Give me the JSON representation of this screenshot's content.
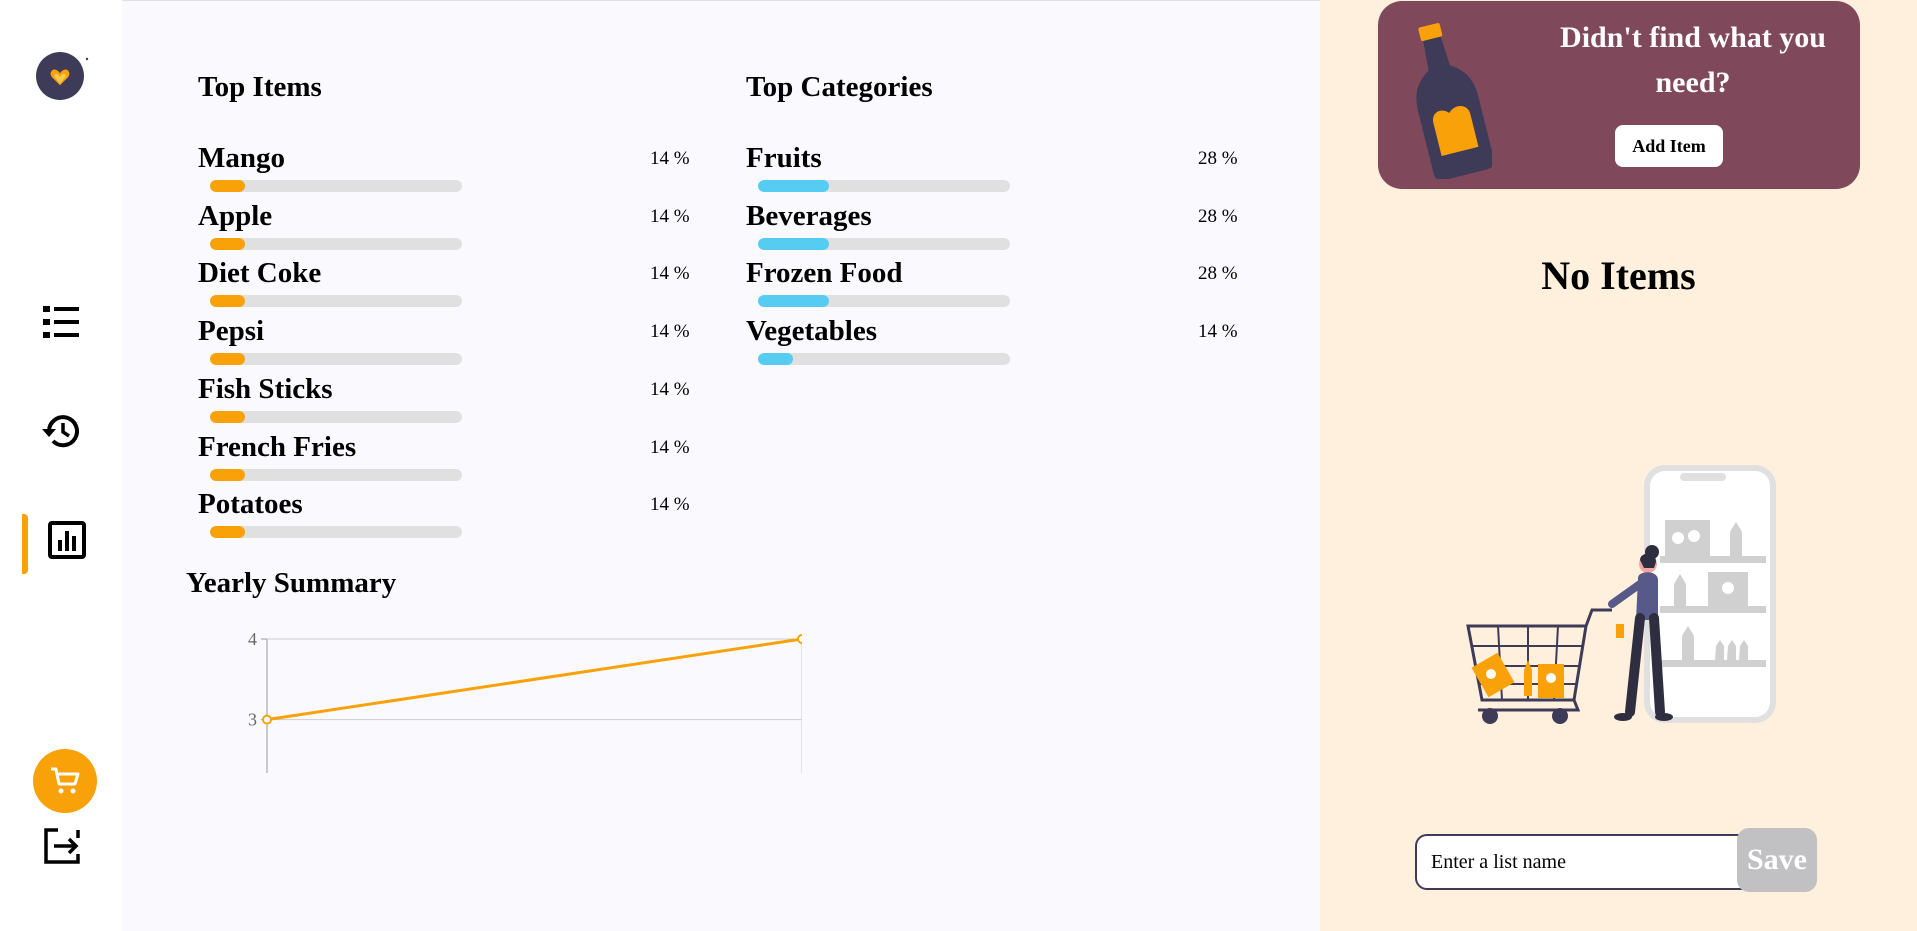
{
  "sidebar": {
    "logo_icon": "heart-logo-icon",
    "nav": [
      {
        "name": "items",
        "icon": "list-icon"
      },
      {
        "name": "history",
        "icon": "history-icon"
      },
      {
        "name": "statistics",
        "icon": "chart-icon",
        "active": true
      }
    ],
    "cart_icon": "cart-icon",
    "logout_icon": "logout-icon"
  },
  "main": {
    "top_items": {
      "title": "Top Items",
      "items": [
        {
          "name": "Mango",
          "pct": "14 %",
          "value": 14
        },
        {
          "name": "Apple",
          "pct": "14 %",
          "value": 14
        },
        {
          "name": "Diet Coke",
          "pct": "14 %",
          "value": 14
        },
        {
          "name": "Pepsi",
          "pct": "14 %",
          "value": 14
        },
        {
          "name": "Fish Sticks",
          "pct": "14 %",
          "value": 14
        },
        {
          "name": "French Fries",
          "pct": "14 %",
          "value": 14
        },
        {
          "name": "Potatoes",
          "pct": "14 %",
          "value": 14
        }
      ]
    },
    "top_categories": {
      "title": "Top Categories",
      "items": [
        {
          "name": "Fruits",
          "pct": "28 %",
          "value": 28
        },
        {
          "name": "Beverages",
          "pct": "28 %",
          "value": 28
        },
        {
          "name": "Frozen Food",
          "pct": "28 %",
          "value": 28
        },
        {
          "name": "Vegetables",
          "pct": "14 %",
          "value": 14
        }
      ]
    },
    "yearly_summary": {
      "title": "Yearly Summary"
    }
  },
  "chart_data": {
    "type": "line",
    "title": "Yearly Summary",
    "xlabel": "",
    "ylabel": "",
    "x": [
      0,
      1
    ],
    "series": [
      {
        "values": [
          3,
          4
        ]
      }
    ],
    "yticks": [
      3,
      4
    ],
    "ylim": [
      2.4,
      4
    ],
    "grid": true
  },
  "right": {
    "promo_text": "Didn't find what you need?",
    "add_item_label": "Add Item",
    "no_items_label": "No Items",
    "list_input_placeholder": "Enter a list name",
    "save_label": "Save"
  },
  "colors": {
    "accent": "#f9a109",
    "category_bar": "#56ccf2",
    "promo_bg": "#80485b",
    "right_bg": "#fff0de",
    "dark": "#3d3b58"
  }
}
